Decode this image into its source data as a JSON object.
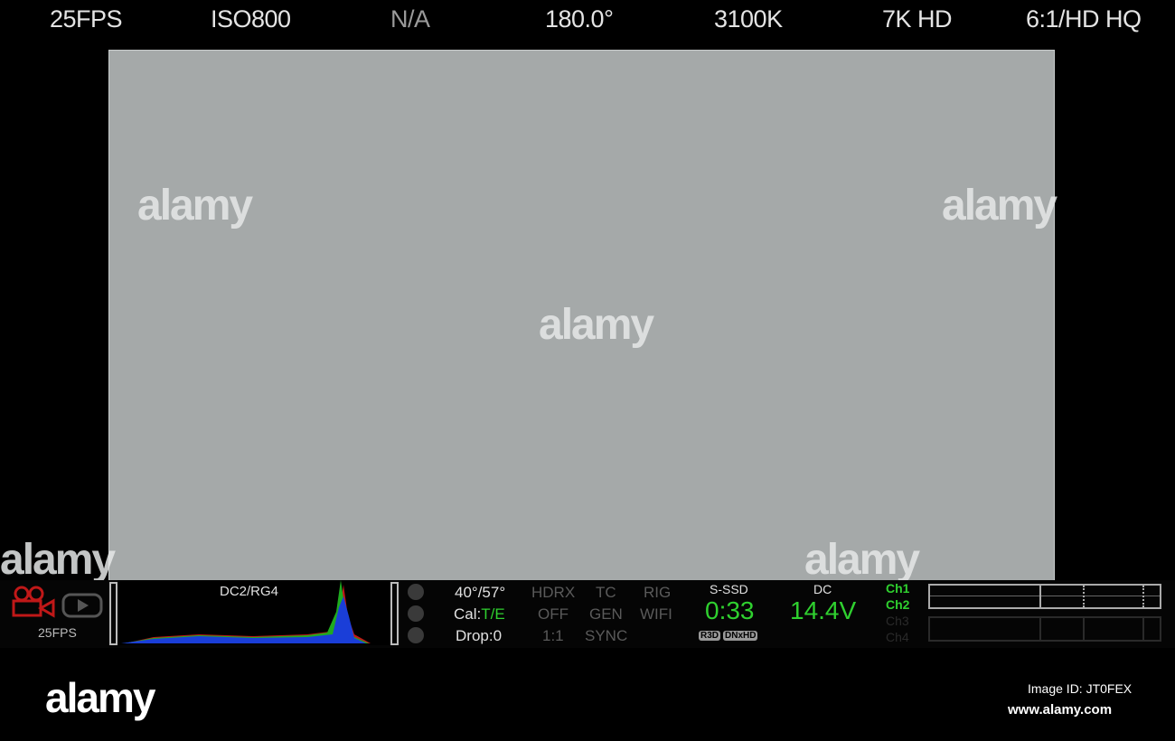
{
  "top_bar": {
    "fps": "25FPS",
    "iso": "ISO800",
    "nd": "N/A",
    "shutter": "180.0°",
    "white_balance": "3100K",
    "resolution": "7K HD",
    "compression": "6:1/HD HQ"
  },
  "histogram": {
    "label": "DC2/RG4"
  },
  "left_panel": {
    "mode_fps": "25FPS"
  },
  "status": {
    "temp": "40°/57°",
    "cal_prefix": "Cal:",
    "cal_value": "T/E",
    "drop": "Drop:0",
    "hdrx": "HDRX",
    "hdrx_value": "OFF",
    "ratio": "1:1",
    "tc": "TC",
    "tc_gen": "GEN",
    "tc_sync": "SYNC",
    "rig": "RIG",
    "wifi": "WIFI"
  },
  "media": {
    "label": "S-SSD",
    "time": "0:33",
    "formats": [
      "R3D",
      "DNxHD"
    ]
  },
  "power": {
    "label": "DC",
    "voltage": "14.4V"
  },
  "audio": {
    "channels": [
      "Ch1",
      "Ch2",
      "Ch3",
      "Ch4"
    ]
  },
  "watermark": {
    "logo": "alamy",
    "image_id": "Image ID: JT0FEX",
    "url": "www.alamy.com"
  },
  "colors": {
    "accent_green": "#2fd02f",
    "record_red": "#c01818",
    "frame_grey": "#a5a9a9"
  }
}
